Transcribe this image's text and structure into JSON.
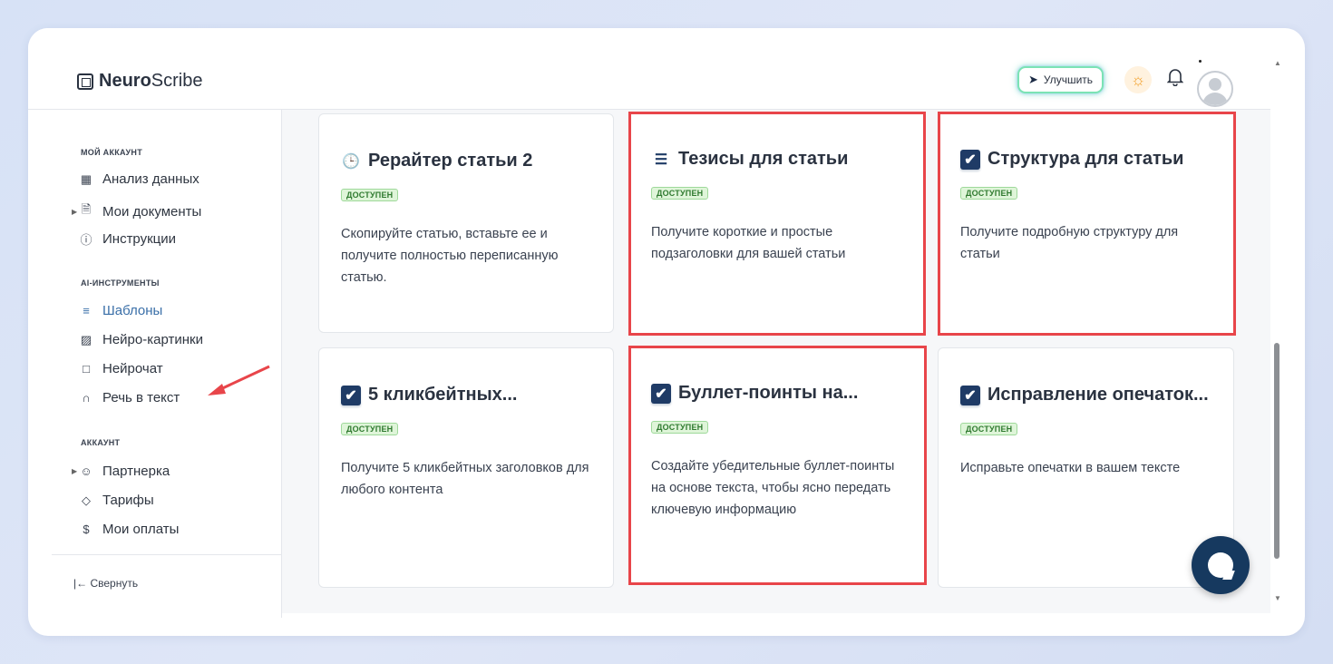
{
  "header": {
    "logo_bold": "Neuro",
    "logo_rest": "Scribe",
    "upgrade_label": "Улучшить",
    "icons": [
      "rocket-icon",
      "sun-icon",
      "bell-icon",
      "avatar"
    ]
  },
  "sidebar": {
    "sections": [
      {
        "title": "МОЙ АККАУНТ",
        "items": [
          {
            "label": "Анализ данных",
            "icon": "grid-icon"
          },
          {
            "label": "Мои документы",
            "icon": "document-icon",
            "expandable": true
          },
          {
            "label": "Инструкции",
            "icon": "help-icon"
          }
        ]
      },
      {
        "title": "AI-ИНСТРУМЕНТЫ",
        "items": [
          {
            "label": "Шаблоны",
            "icon": "layers-icon",
            "active": true
          },
          {
            "label": "Нейро-картинки",
            "icon": "image-icon"
          },
          {
            "label": "Нейрочат",
            "icon": "chat-icon"
          },
          {
            "label": "Речь в текст",
            "icon": "headphones-icon"
          }
        ]
      },
      {
        "title": "АККАУНТ",
        "items": [
          {
            "label": "Партнерка",
            "icon": "users-icon",
            "expandable": true
          },
          {
            "label": "Тарифы",
            "icon": "tag-icon"
          },
          {
            "label": "Мои оплаты",
            "icon": "dollar-icon"
          }
        ]
      }
    ],
    "collapse_label": "Свернуть"
  },
  "cards": [
    {
      "title": "Рерайтер статьи 2",
      "badge": "ДОСТУПЕН",
      "desc": "Скопируйте статью, вставьте ее и получите полностью переписанную статью.",
      "icon": "clock-icon"
    },
    {
      "title": "Тезисы для статьи",
      "badge": "ДОСТУПЕН",
      "desc": "Получите короткие и простые подзаголовки для вашей статьи",
      "icon": "numbered-list-icon"
    },
    {
      "title": "Структура для статьи",
      "badge": "ДОСТУПЕН",
      "desc": "Получите подробную структуру для статьи",
      "icon": "checkbox-icon"
    },
    {
      "title": "5 кликбейтных...",
      "badge": "ДОСТУПЕН",
      "desc": "Получите 5 кликбейтных заголовков для любого контента",
      "icon": "checkbox-icon"
    },
    {
      "title": "Буллет-поинты на...",
      "badge": "ДОСТУПЕН",
      "desc": "Создайте убедительные буллет-поинты на основе текста, чтобы ясно передать ключевую информацию",
      "icon": "checkbox-icon"
    },
    {
      "title": "Исправление опечаток...",
      "badge": "ДОСТУПЕН",
      "desc": "Исправьте опечатки в вашем тексте",
      "icon": "checkbox-icon"
    }
  ],
  "colors": {
    "highlight": "#e8454a",
    "badge_bg": "#dff5d9",
    "accent": "#3a6fa8",
    "chat": "#16395f"
  }
}
